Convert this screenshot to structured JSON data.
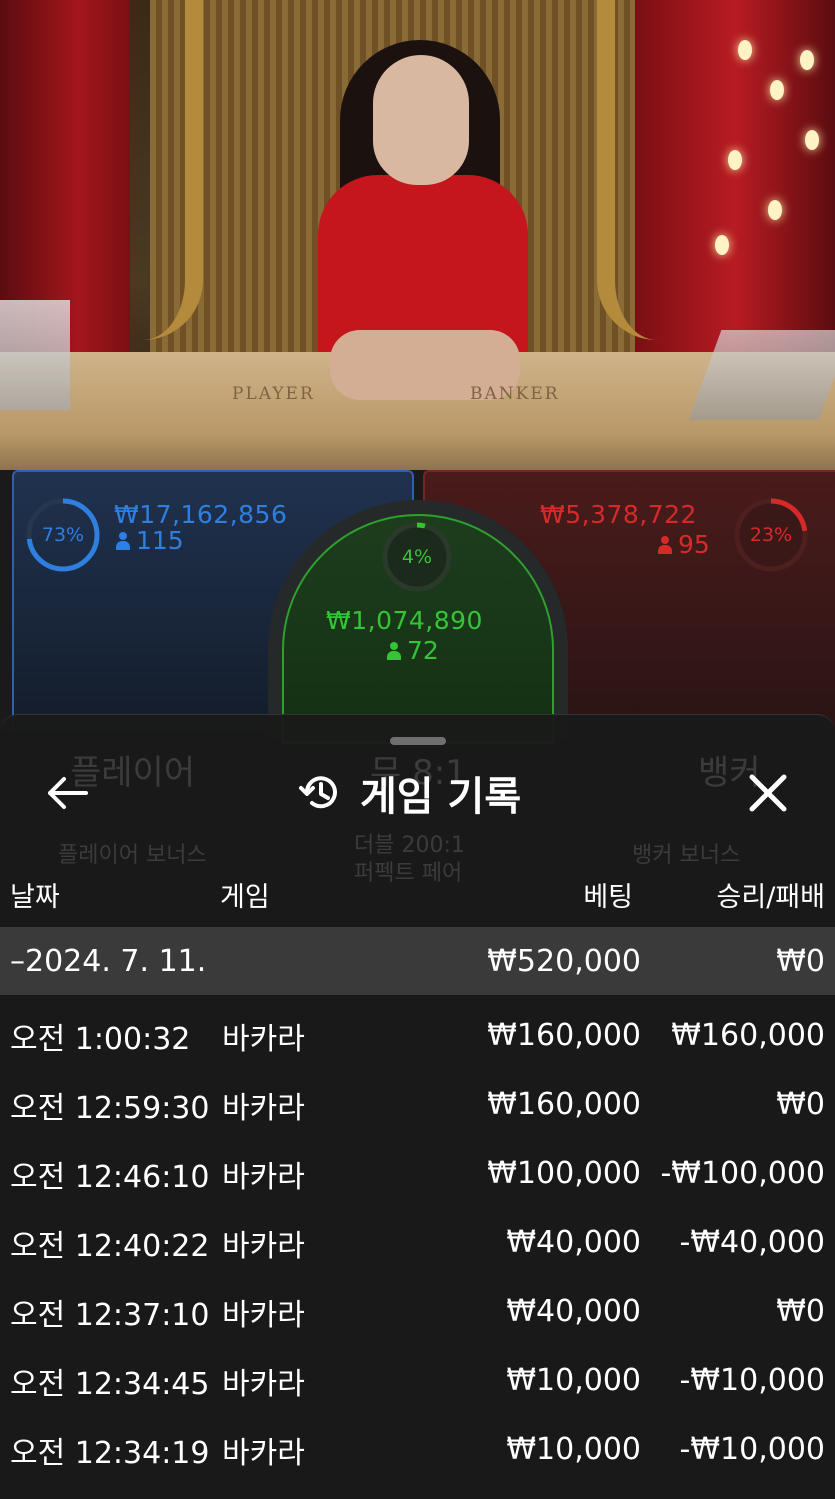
{
  "colors": {
    "player": "#2e7fe0",
    "banker": "#d62a2a",
    "tie": "#35c435",
    "sheet_bg": "#1a1a1a",
    "date_row_bg": "#3a3a3a"
  },
  "video": {
    "table_labels": [
      "PLAYER",
      "BANKER"
    ]
  },
  "betting": {
    "player": {
      "percent": "73%",
      "amount": "₩17,162,856",
      "count": "115",
      "fraction": 0.73
    },
    "tie": {
      "percent": "4%",
      "amount": "₩1,074,890",
      "count": "72",
      "fraction": 0.04
    },
    "banker": {
      "percent": "23%",
      "amount": "₩5,378,722",
      "count": "95",
      "fraction": 0.23
    }
  },
  "background_board": {
    "player_label": "플레이어",
    "tie_label": "무 8:1",
    "banker_label": "뱅커",
    "player_bonus": "플레이어 보너스",
    "tie_side_1": "더블 200:1",
    "tie_side_2": "퍼펙트 페어",
    "banker_bonus": "뱅커 보너스"
  },
  "sheet": {
    "icons": {
      "back": "arrow-left-icon",
      "history": "history-clock-icon",
      "close": "close-icon"
    },
    "title": "게임 기록",
    "columns": {
      "date": "날짜",
      "game": "게임",
      "bet": "베팅",
      "result": "승리/패배"
    },
    "date_group": {
      "date": "–2024. 7. 11.",
      "total_bet": "₩520,000",
      "total_result": "₩0"
    },
    "rows": [
      {
        "time": "오전 1:00:32",
        "game": "바카라",
        "bet": "₩160,000",
        "result": "₩160,000"
      },
      {
        "time": "오전 12:59:30",
        "game": "바카라",
        "bet": "₩160,000",
        "result": "₩0"
      },
      {
        "time": "오전 12:46:10",
        "game": "바카라",
        "bet": "₩100,000",
        "result": "-₩100,000"
      },
      {
        "time": "오전 12:40:22",
        "game": "바카라",
        "bet": "₩40,000",
        "result": "-₩40,000"
      },
      {
        "time": "오전 12:37:10",
        "game": "바카라",
        "bet": "₩40,000",
        "result": "₩0"
      },
      {
        "time": "오전 12:34:45",
        "game": "바카라",
        "bet": "₩10,000",
        "result": "-₩10,000"
      },
      {
        "time": "오전 12:34:19",
        "game": "바카라",
        "bet": "₩10,000",
        "result": "-₩10,000"
      }
    ]
  }
}
